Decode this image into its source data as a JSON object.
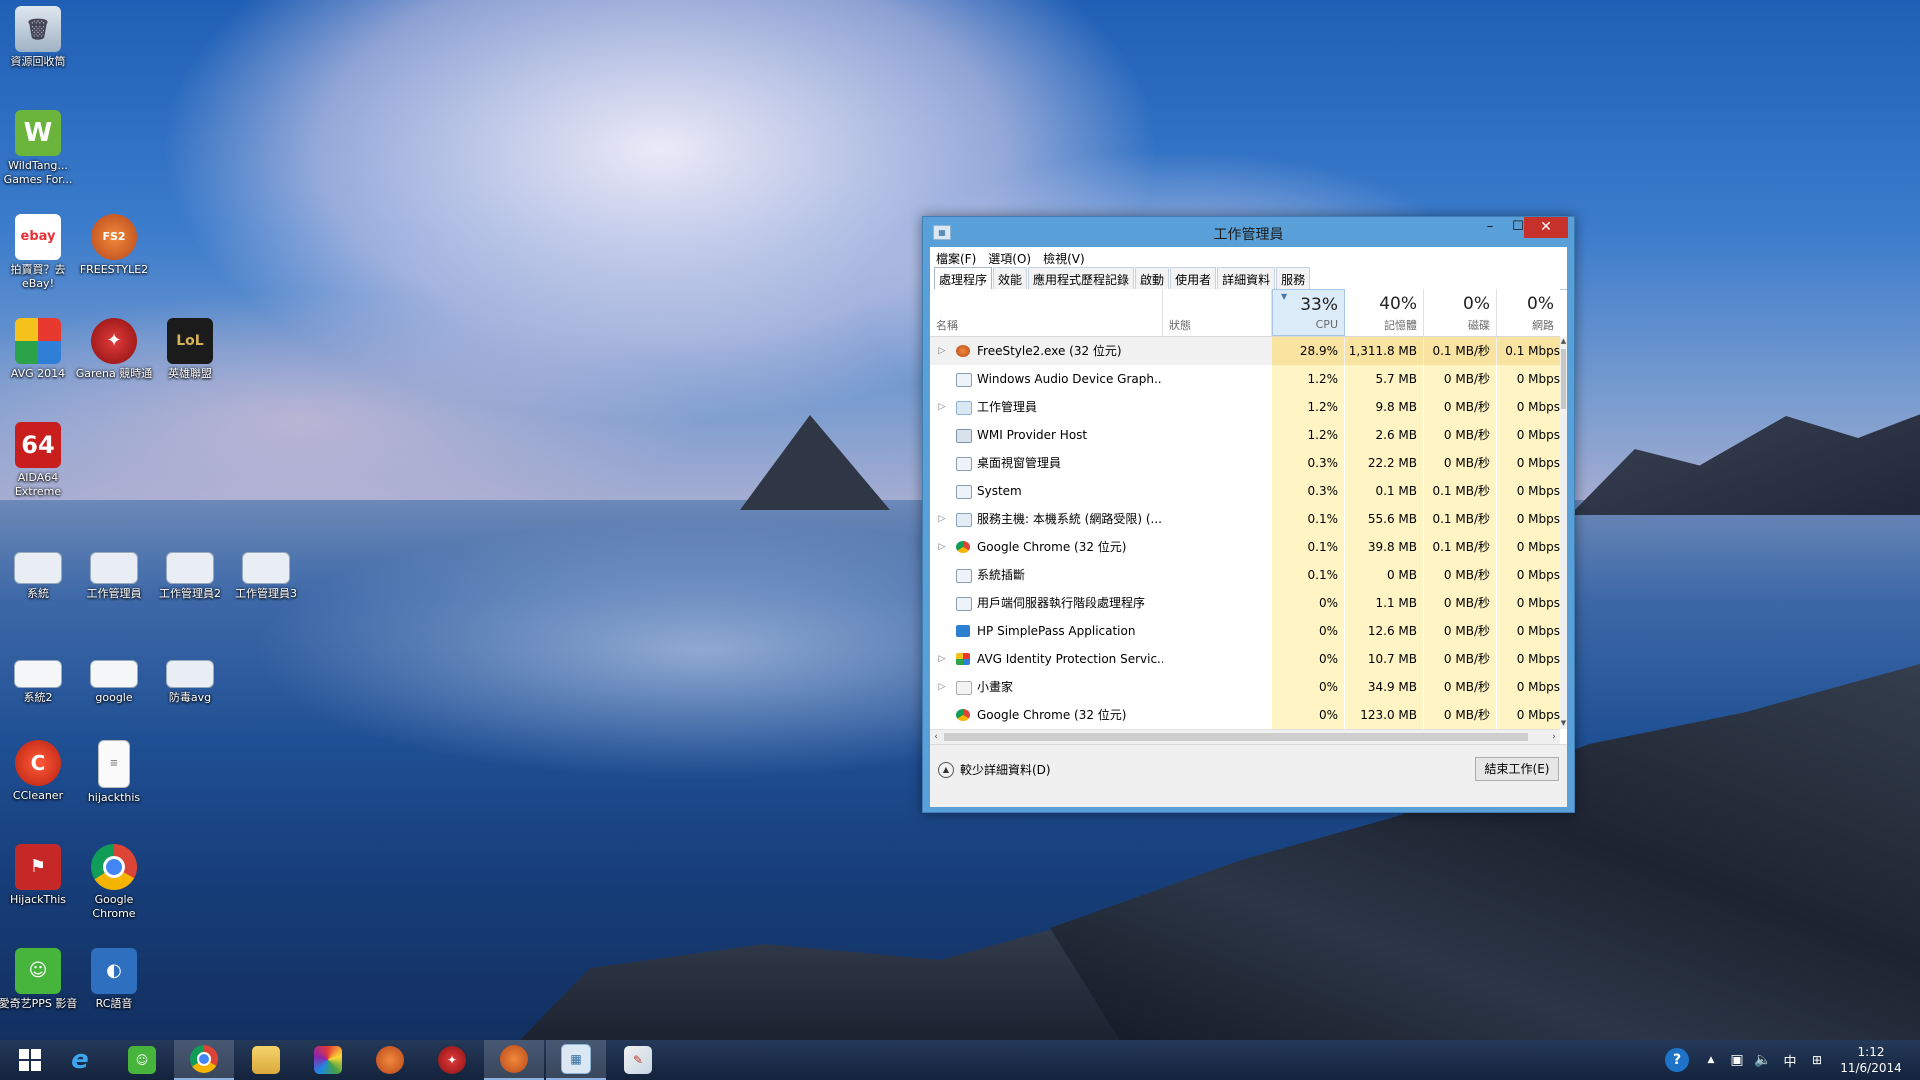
{
  "desktop": {
    "icons": [
      {
        "label": "資源回收筒"
      },
      {
        "label": "WildTang... Games For..."
      },
      {
        "label": "拍賣買？去 eBay!"
      },
      {
        "label": "FREESTYLE2"
      },
      {
        "label": "AVG 2014"
      },
      {
        "label": "Garena 競時通"
      },
      {
        "label": "英雄聯盟"
      },
      {
        "label": "AIDA64 Extreme"
      },
      {
        "label": "系統"
      },
      {
        "label": "工作管理員"
      },
      {
        "label": "工作管理員2"
      },
      {
        "label": "工作管理員3"
      },
      {
        "label": "系統2"
      },
      {
        "label": "google"
      },
      {
        "label": "防毒avg"
      },
      {
        "label": "CCleaner"
      },
      {
        "label": "hijackthis"
      },
      {
        "label": "HijackThis"
      },
      {
        "label": "Google Chrome"
      },
      {
        "label": "愛奇艺PPS 影音"
      },
      {
        "label": "RC語音"
      }
    ],
    "icon_glyphs": {
      "ebay": "ebay",
      "aida": "64",
      "lol": "LoL",
      "fs": "FS2"
    }
  },
  "task_manager": {
    "title": "工作管理員",
    "window_buttons": {
      "minimize": "–",
      "maximize": "☐",
      "close": "✕"
    },
    "menu": [
      "檔案(F)",
      "選項(O)",
      "檢視(V)"
    ],
    "tabs": [
      "處理程序",
      "效能",
      "應用程式歷程記錄",
      "啟動",
      "使用者",
      "詳細資料",
      "服務"
    ],
    "active_tab": "處理程序",
    "columns": {
      "name": "名稱",
      "status": "狀態",
      "cpu": {
        "percent": "33%",
        "label": "CPU"
      },
      "memory": {
        "percent": "40%",
        "label": "記憶體"
      },
      "disk": {
        "percent": "0%",
        "label": "磁碟"
      },
      "network": {
        "percent": "0%",
        "label": "網路"
      }
    },
    "processes": [
      {
        "expand": "▷",
        "icon": "fs-icon",
        "name": "FreeStyle2.exe (32 位元)",
        "cpu": "28.9%",
        "mem": "1,311.8 MB",
        "disk": "0.1 MB/秒",
        "net": "0.1 Mbps"
      },
      {
        "expand": "",
        "icon": "window-icon",
        "name": "Windows Audio Device Graph...",
        "cpu": "1.2%",
        "mem": "5.7 MB",
        "disk": "0 MB/秒",
        "net": "0 Mbps"
      },
      {
        "expand": "▷",
        "icon": "taskmgr-icon",
        "name": "工作管理員",
        "cpu": "1.2%",
        "mem": "9.8 MB",
        "disk": "0 MB/秒",
        "net": "0 Mbps"
      },
      {
        "expand": "",
        "icon": "wmi-icon",
        "name": "WMI Provider Host",
        "cpu": "1.2%",
        "mem": "2.6 MB",
        "disk": "0 MB/秒",
        "net": "0 Mbps"
      },
      {
        "expand": "",
        "icon": "window-icon",
        "name": "桌面視窗管理員",
        "cpu": "0.3%",
        "mem": "22.2 MB",
        "disk": "0 MB/秒",
        "net": "0 Mbps"
      },
      {
        "expand": "",
        "icon": "window-icon",
        "name": "System",
        "cpu": "0.3%",
        "mem": "0.1 MB",
        "disk": "0.1 MB/秒",
        "net": "0 Mbps"
      },
      {
        "expand": "▷",
        "icon": "service-icon",
        "name": "服務主機: 本機系統 (網路受限) (...",
        "cpu": "0.1%",
        "mem": "55.6 MB",
        "disk": "0.1 MB/秒",
        "net": "0 Mbps"
      },
      {
        "expand": "▷",
        "icon": "chrome-icon",
        "name": "Google Chrome (32 位元)",
        "cpu": "0.1%",
        "mem": "39.8 MB",
        "disk": "0.1 MB/秒",
        "net": "0 Mbps"
      },
      {
        "expand": "",
        "icon": "window-icon",
        "name": "系統插斷",
        "cpu": "0.1%",
        "mem": "0 MB",
        "disk": "0 MB/秒",
        "net": "0 Mbps"
      },
      {
        "expand": "",
        "icon": "window-icon",
        "name": "用戶端伺服器執行階段處理程序",
        "cpu": "0%",
        "mem": "1.1 MB",
        "disk": "0 MB/秒",
        "net": "0 Mbps"
      },
      {
        "expand": "",
        "icon": "hp-icon",
        "name": "HP SimplePass Application",
        "cpu": "0%",
        "mem": "12.6 MB",
        "disk": "0 MB/秒",
        "net": "0 Mbps"
      },
      {
        "expand": "▷",
        "icon": "avg-icon",
        "name": "AVG Identity Protection Servic...",
        "cpu": "0%",
        "mem": "10.7 MB",
        "disk": "0 MB/秒",
        "net": "0 Mbps"
      },
      {
        "expand": "▷",
        "icon": "paint-icon",
        "name": "小畫家",
        "cpu": "0%",
        "mem": "34.9 MB",
        "disk": "0 MB/秒",
        "net": "0 Mbps"
      },
      {
        "expand": "",
        "icon": "chrome-icon",
        "name": "Google Chrome (32 位元)",
        "cpu": "0%",
        "mem": "123.0 MB",
        "disk": "0 MB/秒",
        "net": "0 Mbps"
      }
    ],
    "fewer_details": "較少詳細資料(D)",
    "end_task": "結束工作(E)"
  },
  "taskbar": {
    "clock_time": "1:12",
    "clock_date": "11/6/2014",
    "ime": "中",
    "help": "?"
  },
  "colors": {
    "window_frame": "#5aa0d8",
    "close_button": "#c7312b",
    "heat_cell": "#fff4c4",
    "taskbar": "#12284b"
  }
}
